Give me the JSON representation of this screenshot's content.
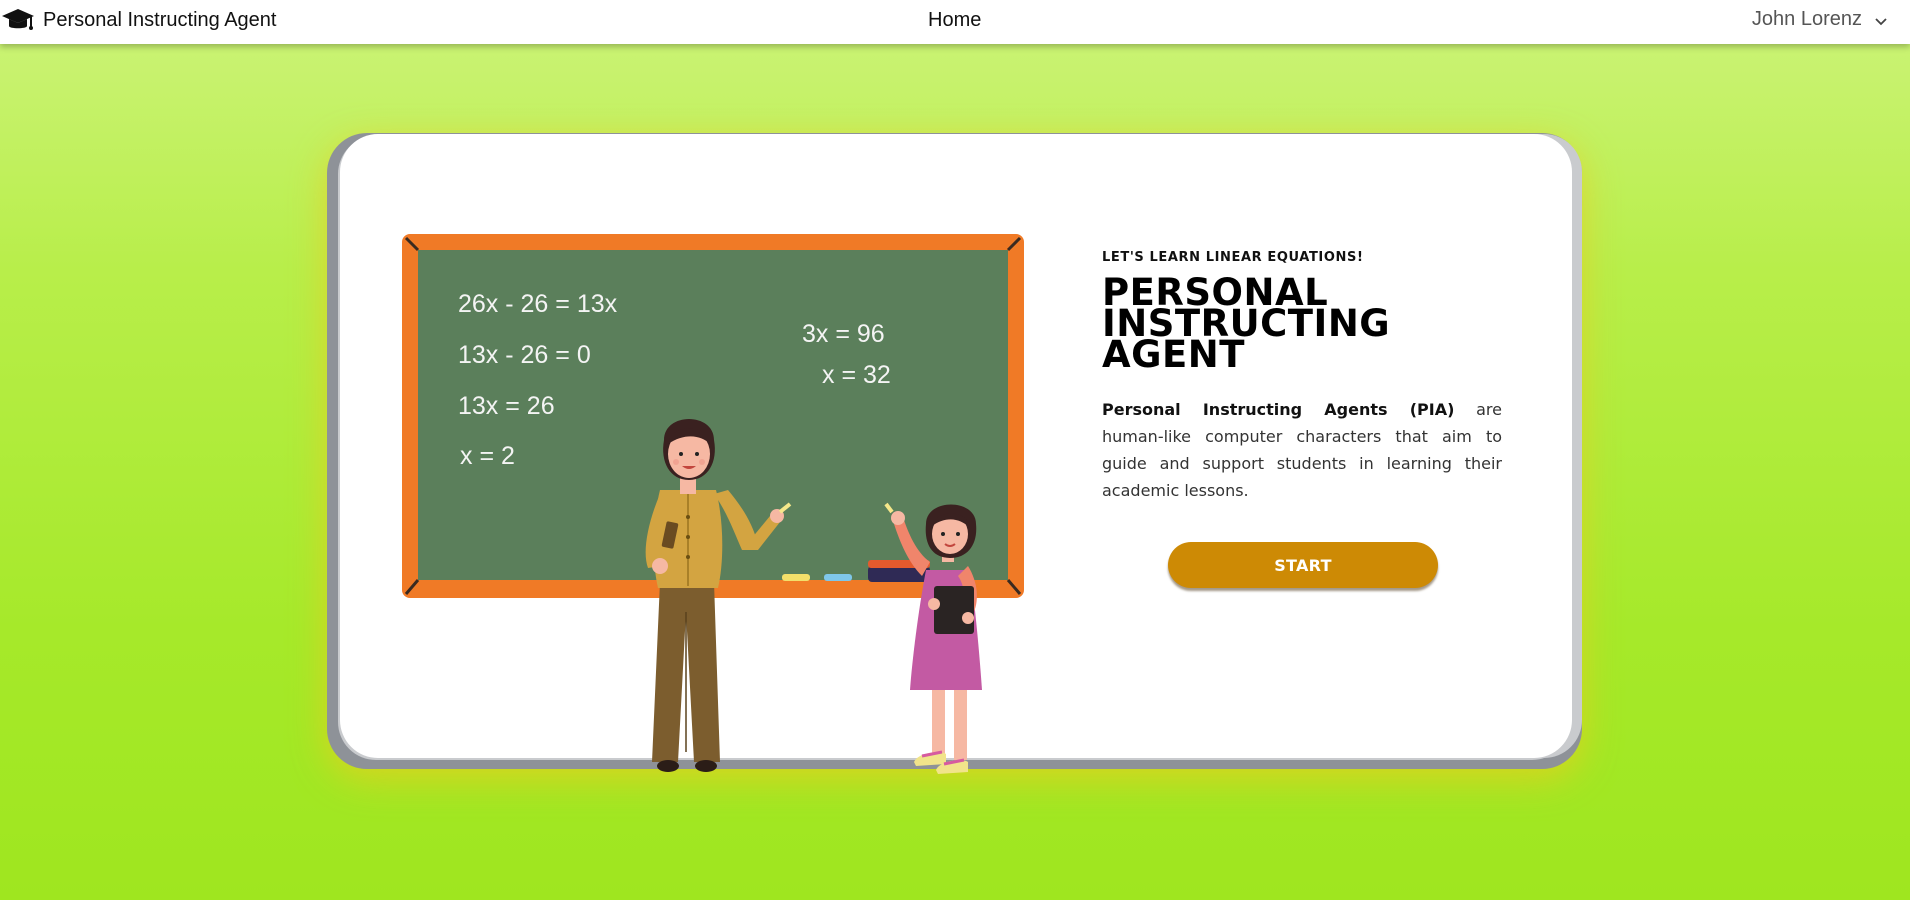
{
  "navbar": {
    "brand_icon": "graduation-cap-icon",
    "brand_title": "Personal Instructing Agent",
    "home_label": "Home",
    "user_name": "John Lorenz",
    "user_menu_icon": "chevron-down-icon"
  },
  "hero": {
    "eyebrow": "LET'S LEARN LINEAR EQUATIONS!",
    "title": "PERSONAL INSTRUCTING AGENT",
    "description_bold": "Personal Instructing Agents (PIA)",
    "description_rest": " are human-like computer characters that aim to guide and support students in learning their academic lessons.",
    "start_label": "START",
    "start_color": "#cd8a05"
  },
  "illustration": {
    "board_equations": [
      "26x - 26 = 13x",
      "13x  - 26 = 0",
      "13x  = 26",
      "x = 2"
    ],
    "teacher_equations": [
      "3x = 96",
      "x = 32"
    ],
    "board_color": "#5b7f5b",
    "frame_color": "#f07a26"
  },
  "theme": {
    "background_top": "#cdf47a",
    "background_bottom": "#9fe61f"
  }
}
